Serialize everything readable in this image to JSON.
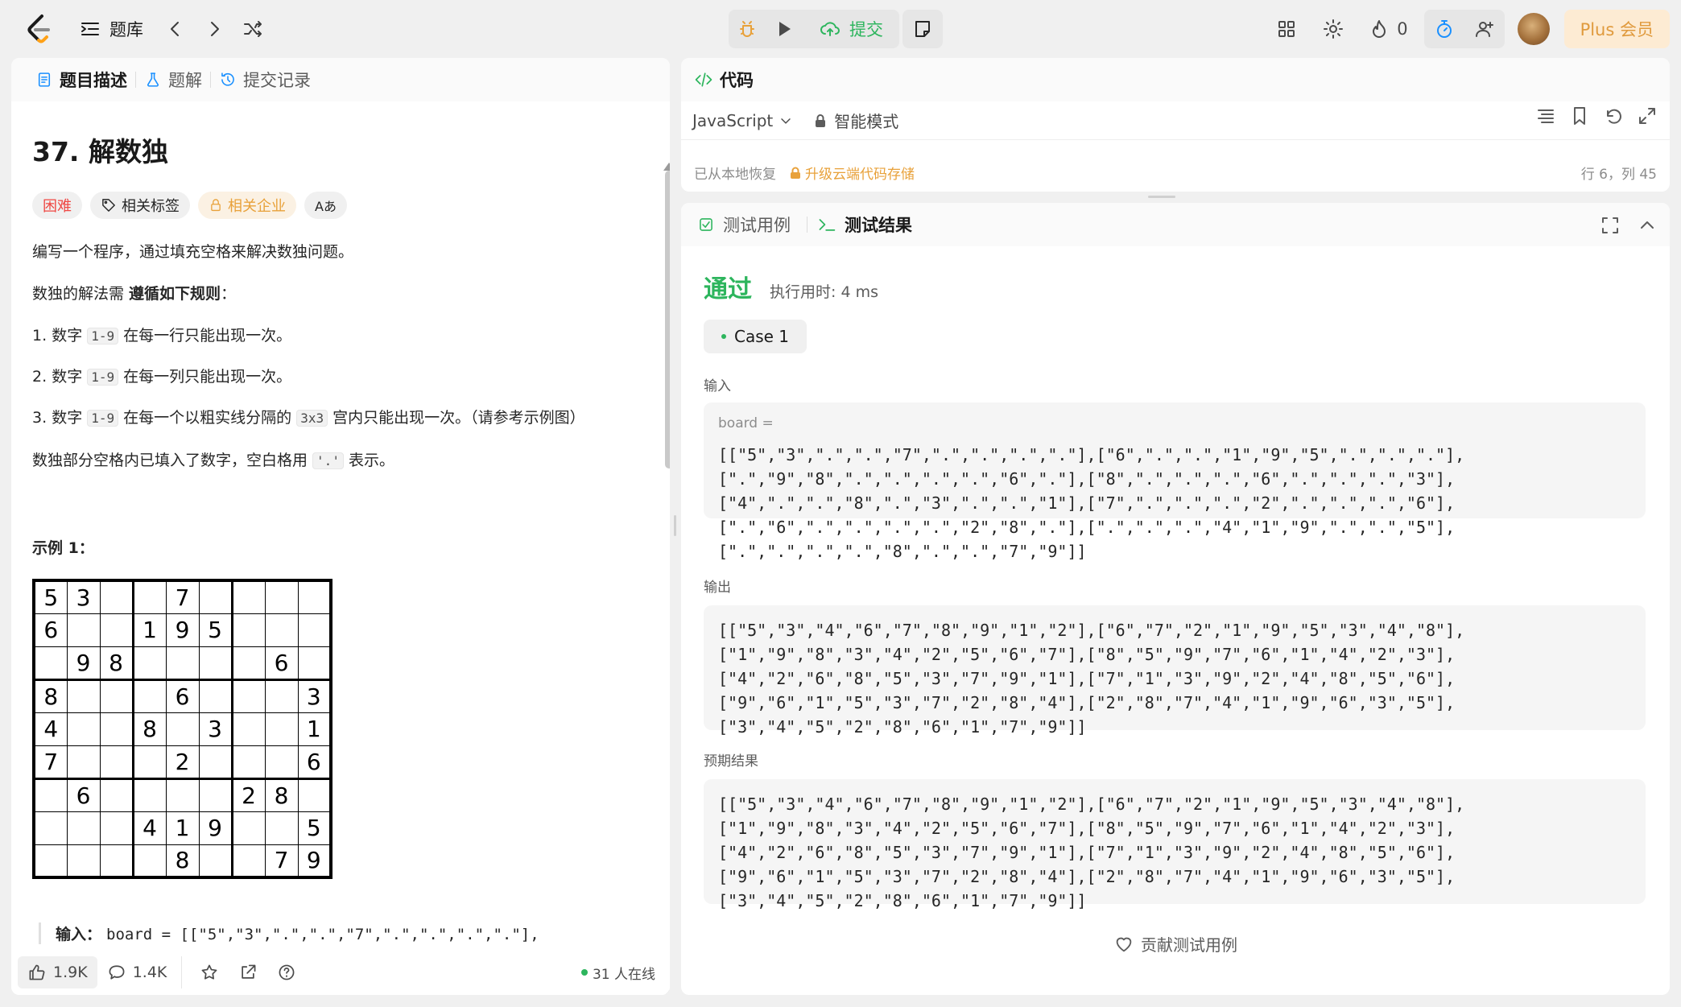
{
  "topbar": {
    "library_label": "题库",
    "submit_label": "提交",
    "streak_count": "0",
    "plus_label": "Plus 会员"
  },
  "left": {
    "tabs": [
      "题目描述",
      "题解",
      "提交记录"
    ],
    "title": "37. 解数独",
    "tags": {
      "difficulty": "困难",
      "related_tags": "相关标签",
      "companies": "相关企业",
      "translate": "Aあ"
    },
    "intro": "编写一个程序，通过填充空格来解决数独问题。",
    "rules_lead_1": "数独的解法需 ",
    "rules_lead_bold": "遵循如下规则",
    "rules_lead_2": "：",
    "rules": [
      {
        "num": "1.",
        "pre": "数字 ",
        "code": "1-9",
        "post": " 在每一行只能出现一次。",
        "code2": "",
        "post2": ""
      },
      {
        "num": "2.",
        "pre": "数字 ",
        "code": "1-9",
        "post": " 在每一列只能出现一次。",
        "code2": "",
        "post2": ""
      },
      {
        "num": "3.",
        "pre": "数字 ",
        "code": "1-9",
        "post": " 在每一个以粗实线分隔的 ",
        "code2": "3x3",
        "post2": " 宫内只能出现一次。（请参考示例图）"
      }
    ],
    "blank_pre": "数独部分空格内已填入了数字，空白格用 ",
    "blank_code": "'.'",
    "blank_post": " 表示。",
    "example_title": "示例 1：",
    "grid": [
      [
        "5",
        "3",
        "",
        "",
        "7",
        "",
        "",
        "",
        ""
      ],
      [
        "6",
        "",
        "",
        "1",
        "9",
        "5",
        "",
        "",
        ""
      ],
      [
        "",
        "9",
        "8",
        "",
        "",
        "",
        "",
        "6",
        ""
      ],
      [
        "8",
        "",
        "",
        "",
        "6",
        "",
        "",
        "",
        "3"
      ],
      [
        "4",
        "",
        "",
        "8",
        "",
        "3",
        "",
        "",
        "1"
      ],
      [
        "7",
        "",
        "",
        "",
        "2",
        "",
        "",
        "",
        "6"
      ],
      [
        "",
        "6",
        "",
        "",
        "",
        "",
        "2",
        "8",
        ""
      ],
      [
        "",
        "",
        "",
        "4",
        "1",
        "9",
        "",
        "",
        "5"
      ],
      [
        "",
        "",
        "",
        "",
        "8",
        "",
        "",
        "7",
        "9"
      ]
    ],
    "example_input_label": "输入：",
    "example_input_value": "board = [[\"5\",\"3\",\".\",\".\",\"7\",\".\",\".\",\".\",\".\"],",
    "footer": {
      "likes": "1.9K",
      "comments": "1.4K",
      "online": "31 人在线"
    }
  },
  "code": {
    "title": "代码",
    "language": "JavaScript",
    "mode": "智能模式",
    "restored": "已从本地恢复",
    "upgrade": "升级云端代码存储",
    "position": "行 6，列 45"
  },
  "result": {
    "tabs": [
      "测试用例",
      "测试结果"
    ],
    "status": "通过",
    "runtime": "执行用时: 4 ms",
    "case_label": "Case 1",
    "input_label": "输入",
    "board_label": "board =",
    "input_value": "[[\"5\",\"3\",\".\",\".\",\"7\",\".\",\".\",\".\",\".\"],[\"6\",\".\",\".\",\"1\",\"9\",\"5\",\".\",\".\",\".\"],[\".\",\"9\",\"8\",\".\",\".\",\".\",\".\",\"6\",\".\"],[\"8\",\".\",\".\",\".\",\"6\",\".\",\".\",\".\",\"3\"],[\"4\",\".\",\".\",\"8\",\".\",\"3\",\".\",\".\",\"1\"],[\"7\",\".\",\".\",\".\",\"2\",\".\",\".\",\".\",\"6\"],[\".\",\"6\",\".\",\".\",\".\",\".\",\"2\",\"8\",\".\"],[\".\",\".\",\".\",\"4\",\"1\",\"9\",\".\",\".\",\"5\"],[\".\",\".\",\".\",\".\",\"8\",\".\",\".\",\"7\",\"9\"]]",
    "output_label": "输出",
    "output_value": "[[\"5\",\"3\",\"4\",\"6\",\"7\",\"8\",\"9\",\"1\",\"2\"],[\"6\",\"7\",\"2\",\"1\",\"9\",\"5\",\"3\",\"4\",\"8\"],[\"1\",\"9\",\"8\",\"3\",\"4\",\"2\",\"5\",\"6\",\"7\"],[\"8\",\"5\",\"9\",\"7\",\"6\",\"1\",\"4\",\"2\",\"3\"],[\"4\",\"2\",\"6\",\"8\",\"5\",\"3\",\"7\",\"9\",\"1\"],[\"7\",\"1\",\"3\",\"9\",\"2\",\"4\",\"8\",\"5\",\"6\"],[\"9\",\"6\",\"1\",\"5\",\"3\",\"7\",\"2\",\"8\",\"4\"],[\"2\",\"8\",\"7\",\"4\",\"1\",\"9\",\"6\",\"3\",\"5\"],[\"3\",\"4\",\"5\",\"2\",\"8\",\"6\",\"1\",\"7\",\"9\"]]",
    "expected_label": "预期结果",
    "expected_value": "[[\"5\",\"3\",\"4\",\"6\",\"7\",\"8\",\"9\",\"1\",\"2\"],[\"6\",\"7\",\"2\",\"1\",\"9\",\"5\",\"3\",\"4\",\"8\"],[\"1\",\"9\",\"8\",\"3\",\"4\",\"2\",\"5\",\"6\",\"7\"],[\"8\",\"5\",\"9\",\"7\",\"6\",\"1\",\"4\",\"2\",\"3\"],[\"4\",\"2\",\"6\",\"8\",\"5\",\"3\",\"7\",\"9\",\"1\"],[\"7\",\"1\",\"3\",\"9\",\"2\",\"4\",\"8\",\"5\",\"6\"],[\"9\",\"6\",\"1\",\"5\",\"3\",\"7\",\"2\",\"8\",\"4\"],[\"2\",\"8\",\"7\",\"4\",\"1\",\"9\",\"6\",\"3\",\"5\"],[\"3\",\"4\",\"5\",\"2\",\"8\",\"6\",\"1\",\"7\",\"9\"]]",
    "contribute": "贡献测试用例"
  },
  "colors": {
    "accent_green": "#2db55d",
    "hard_red": "#ef4743",
    "premium_orange": "#e8a13a"
  },
  "icons": [
    "logo-icon",
    "list-icon",
    "chevron-left-icon",
    "chevron-right-icon",
    "shuffle-icon",
    "debug-icon",
    "play-icon",
    "cloud-upload-icon",
    "note-icon",
    "layout-icon",
    "gear-icon",
    "fire-icon",
    "timer-icon",
    "add-friend-icon",
    "description-icon",
    "flask-icon",
    "history-icon",
    "tag-icon",
    "lock-icon",
    "code-icon",
    "format-icon",
    "bookmark-icon",
    "undo-icon",
    "expand-icon",
    "checkbox-icon",
    "terminal-icon",
    "fullscreen-icon",
    "chevron-up-icon",
    "thumb-up-icon",
    "comment-icon",
    "star-icon",
    "share-icon",
    "help-icon",
    "heart-icon"
  ]
}
